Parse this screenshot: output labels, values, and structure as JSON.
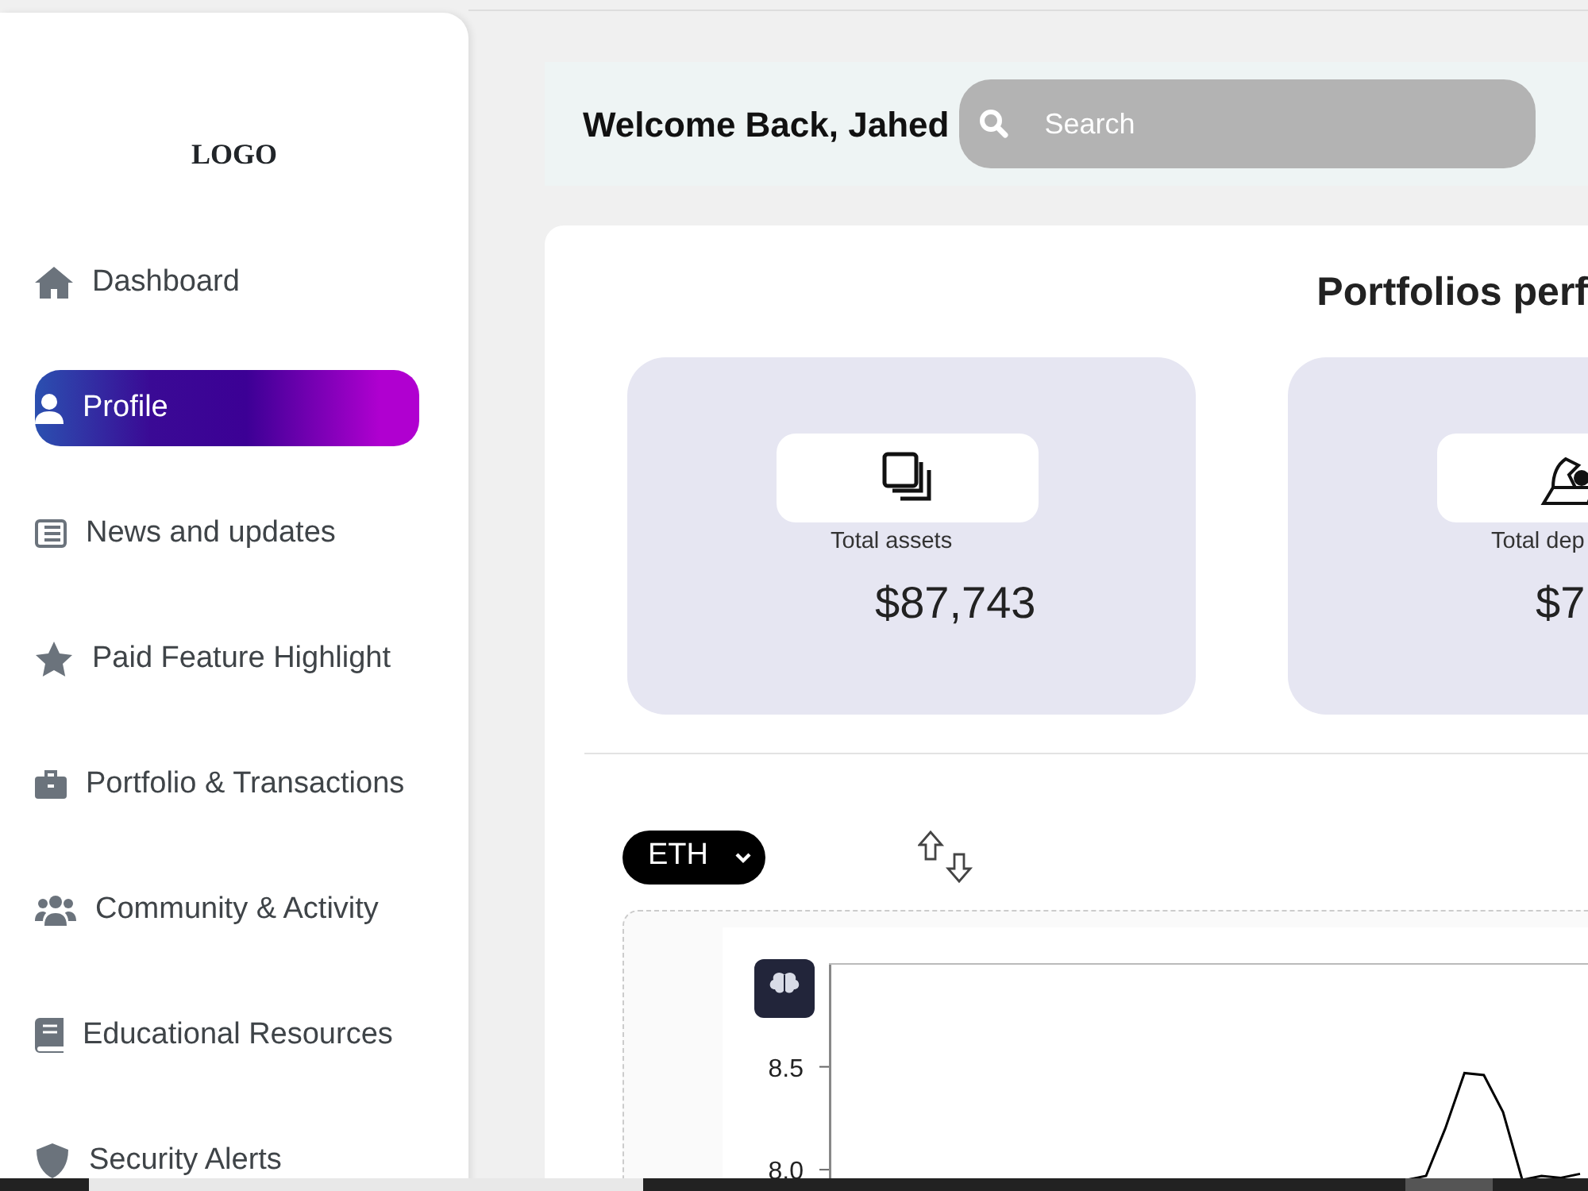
{
  "logo": "LOGO",
  "sidebar": {
    "items": [
      {
        "label": "Dashboard",
        "selected": false
      },
      {
        "label": "Profile",
        "selected": true
      },
      {
        "label": "News and updates",
        "selected": false
      },
      {
        "label": "Paid Feature Highlight",
        "selected": false
      },
      {
        "label": "Portfolio & Transactions",
        "selected": false
      },
      {
        "label": "Community & Activity",
        "selected": false
      },
      {
        "label": "Educational Resources",
        "selected": false
      },
      {
        "label": "Security Alerts",
        "selected": false
      }
    ]
  },
  "header": {
    "greeting": "Welcome Back, Jahed",
    "search": {
      "placeholder": "Search"
    }
  },
  "portfolio": {
    "title": "Portfolios perf",
    "cards": [
      {
        "label": "Total assets",
        "value": "$87,743"
      },
      {
        "label": "Total dep",
        "value": "$7"
      }
    ],
    "coin_select": {
      "value": "ETH"
    },
    "chart_data": {
      "type": "line",
      "ylim": [
        7.85,
        9.0
      ],
      "yticks": [
        {
          "value": 8,
          "label": "8.0"
        },
        {
          "value": 8.5,
          "label": "8.5"
        }
      ],
      "series": [
        {
          "color": "#000000",
          "values": [
            null,
            null,
            null,
            null,
            null,
            null,
            null,
            null,
            null,
            null,
            null,
            null,
            null,
            null,
            null,
            null,
            null,
            null,
            null,
            null,
            null,
            null,
            null,
            null,
            null,
            null,
            null,
            null,
            null,
            null,
            7.95,
            7.97,
            8.2,
            8.47,
            8.46,
            8.28,
            7.95,
            7.97,
            7.96,
            7.98
          ]
        }
      ]
    }
  }
}
